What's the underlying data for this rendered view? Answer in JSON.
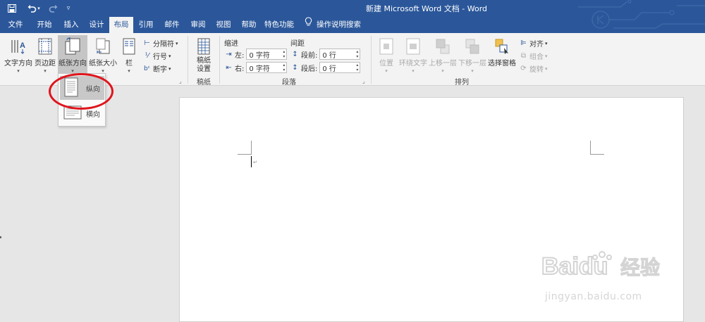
{
  "window": {
    "title": "新建 Microsoft Word 文档 - Word"
  },
  "quick_access": {
    "icons": [
      "save-icon",
      "undo-icon",
      "undo-menu-caret",
      "redo-icon",
      "customize-icon"
    ]
  },
  "tabs": [
    {
      "label": "文件"
    },
    {
      "label": "开始"
    },
    {
      "label": "插入"
    },
    {
      "label": "设计"
    },
    {
      "label": "布局",
      "active": true
    },
    {
      "label": "引用"
    },
    {
      "label": "邮件"
    },
    {
      "label": "审阅"
    },
    {
      "label": "视图"
    },
    {
      "label": "帮助"
    },
    {
      "label": "特色功能"
    }
  ],
  "tell_me": {
    "label": "操作说明搜索"
  },
  "ribbon": {
    "page_setup": {
      "text_direction": "文字方向",
      "margins": "页边距",
      "orientation": "纸张方向",
      "size": "纸张大小",
      "columns": "栏",
      "breaks": "分隔符",
      "line_numbers": "行号",
      "hyphenation": "断字"
    },
    "manuscript": {
      "button": "稿纸设置",
      "button_line1": "稿纸",
      "button_line2": "设置",
      "group": "稿纸"
    },
    "paragraph": {
      "indent_header": "缩进",
      "spacing_header": "间距",
      "left_label": "左:",
      "left_value": "0 字符",
      "right_label": "右:",
      "right_value": "0 字符",
      "before_label": "段前:",
      "before_value": "0 行",
      "after_label": "段后:",
      "after_value": "0 行",
      "group": "段落"
    },
    "arrange": {
      "position": "位置",
      "wrap_text": "环绕文字",
      "bring_forward": "上移一层",
      "send_backward": "下移一层",
      "selection_pane": "选择窗格",
      "align": "对齐",
      "group_objects": "组合",
      "rotate": "旋转",
      "group": "排列"
    }
  },
  "orientation_menu": {
    "portrait": "纵向",
    "landscape": "横向",
    "selected": "纵向"
  },
  "document": {
    "paragraph_mark": "↵"
  },
  "watermark": {
    "brand": "Baidu",
    "brand_suffix": "经验",
    "url": "jingyan.baidu.com"
  },
  "colors": {
    "accent": "#2b579a",
    "ribbon": "#f3f3f3",
    "highlight_ellipse": "#e0141c"
  }
}
